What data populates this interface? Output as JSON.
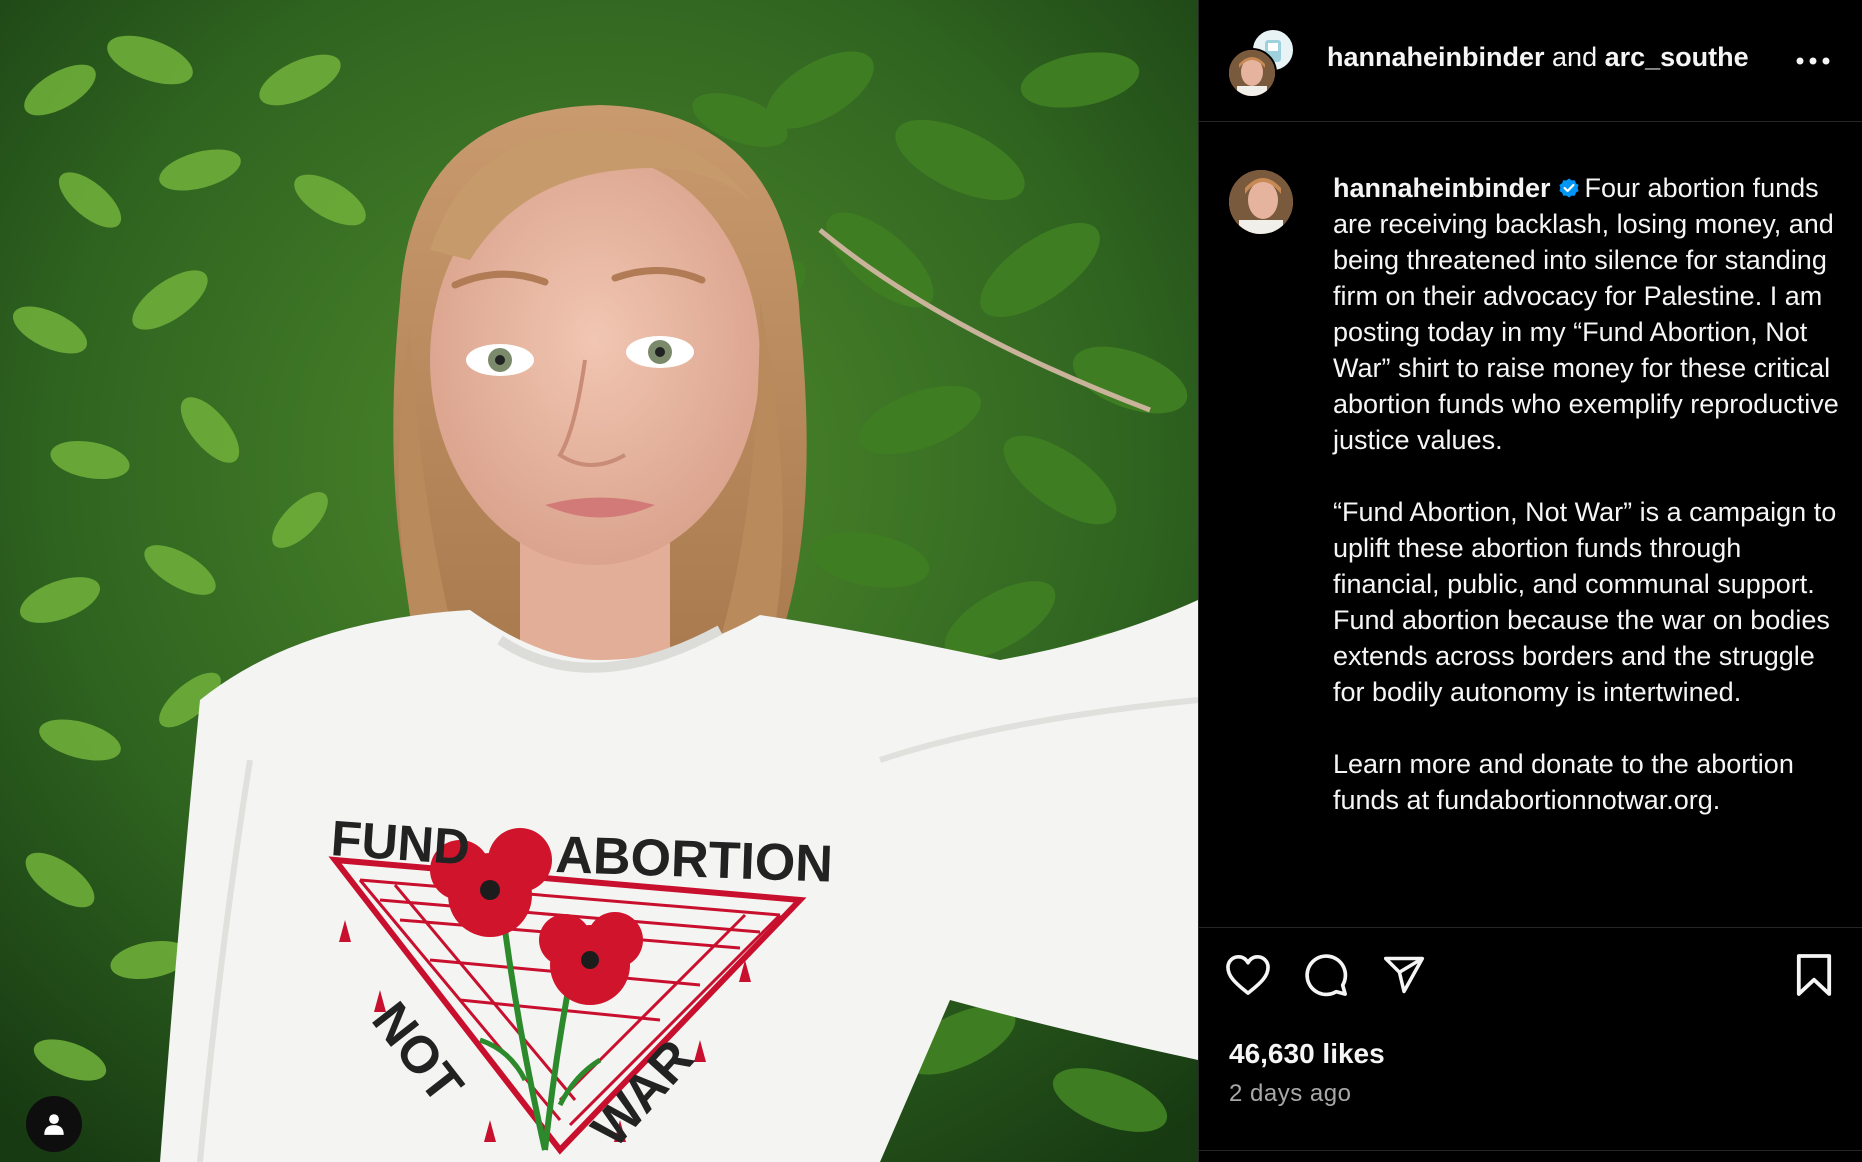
{
  "header": {
    "user1": "hannaheinbinder",
    "connector": " and ",
    "user2": "arc_southe"
  },
  "caption": {
    "username": "hannaheinbinder",
    "paragraphs": [
      "Four abortion funds are receiving backlash, losing money, and being threatened into silence for standing firm on their advocacy for Palestine. I am posting today in my “Fund Abortion, Not War” shirt to raise money for these critical abortion funds who exemplify reproductive justice values.",
      "“Fund Abortion, Not War” is a campaign to uplift these abortion funds through financial, public, and communal support. Fund abortion because the war on bodies extends across borders and the struggle for bodily autonomy is intertwined.",
      "Learn more and donate to the abortion funds at fundabortionnotwar.org."
    ]
  },
  "shirt": {
    "word1": "FUND",
    "word2": "ABORTION",
    "word3": "NOT",
    "word4": "WAR"
  },
  "stats": {
    "likes": "46,630 likes",
    "time": "2 days ago"
  },
  "icons": {
    "more": "more-horizontal-icon",
    "like": "heart-icon",
    "comment": "comment-icon",
    "share": "paper-plane-icon",
    "save": "bookmark-icon",
    "verified": "verified-badge-icon",
    "tag": "user-tag-icon"
  },
  "colors": {
    "background": "#000000",
    "text": "#f5f5f5",
    "secondary_text": "#a8a8a8",
    "divider": "#262626",
    "verified": "#0095f6",
    "shirt_red": "#c8102e"
  }
}
